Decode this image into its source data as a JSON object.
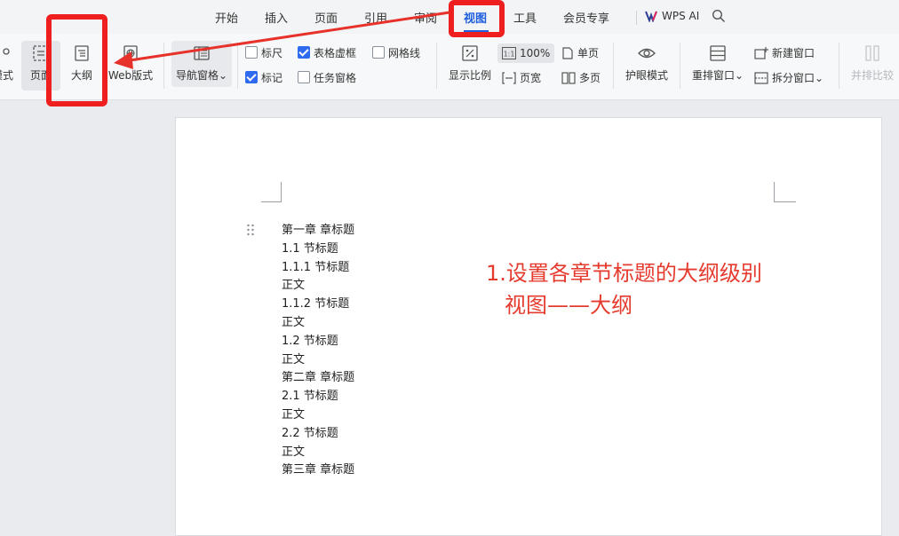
{
  "tabs": [
    {
      "label": "开始"
    },
    {
      "label": "插入"
    },
    {
      "label": "页面"
    },
    {
      "label": "引用"
    },
    {
      "label": "审阅"
    },
    {
      "label": "视图"
    },
    {
      "label": "工具"
    },
    {
      "label": "会员专享"
    }
  ],
  "active_tab": "视图",
  "wps_ai_label": "WPS AI",
  "ribbon": {
    "mode_partial_label": "模式",
    "page_view_label": "页面",
    "outline_label": "大纲",
    "web_layout_label": "Web版式",
    "nav_pane_label": "导航窗格",
    "ruler_label": "标尺",
    "table_gridlines_label": "表格虚框",
    "gridlines_label": "网格线",
    "marks_label": "标记",
    "task_pane_label": "任务窗格",
    "zoom_label": "显示比例",
    "zoom_100_label": "100%",
    "page_width_label": "页宽",
    "single_page_label": "单页",
    "multi_page_label": "多页",
    "eye_mode_label": "护眼模式",
    "rearrange_label": "重排窗口",
    "new_window_label": "新建窗口",
    "split_window_label": "拆分窗口",
    "side_by_side_label": "并排比较"
  },
  "checkboxes": {
    "ruler": false,
    "table_gridlines": true,
    "gridlines": false,
    "marks": true,
    "task_pane": false
  },
  "document": {
    "lines": [
      "第一章 章标题",
      "1.1  节标题",
      "1.1.1  节标题",
      "正文",
      "1.1.2  节标题",
      "正文",
      "1.2  节标题",
      "正文",
      "第二章  章标题",
      "2.1  节标题",
      "正文",
      "2.2  节标题",
      "正文",
      "第三章  章标题"
    ]
  },
  "annotation": {
    "line1": "1.设置各章节标题的大纲级别",
    "line2": "视图——大纲"
  },
  "colors": {
    "accent": "#1e5fe0",
    "highlight_red": "#f01f1f",
    "annotation_red": "#e53b2e",
    "checkbox_blue": "#2f6bef"
  }
}
